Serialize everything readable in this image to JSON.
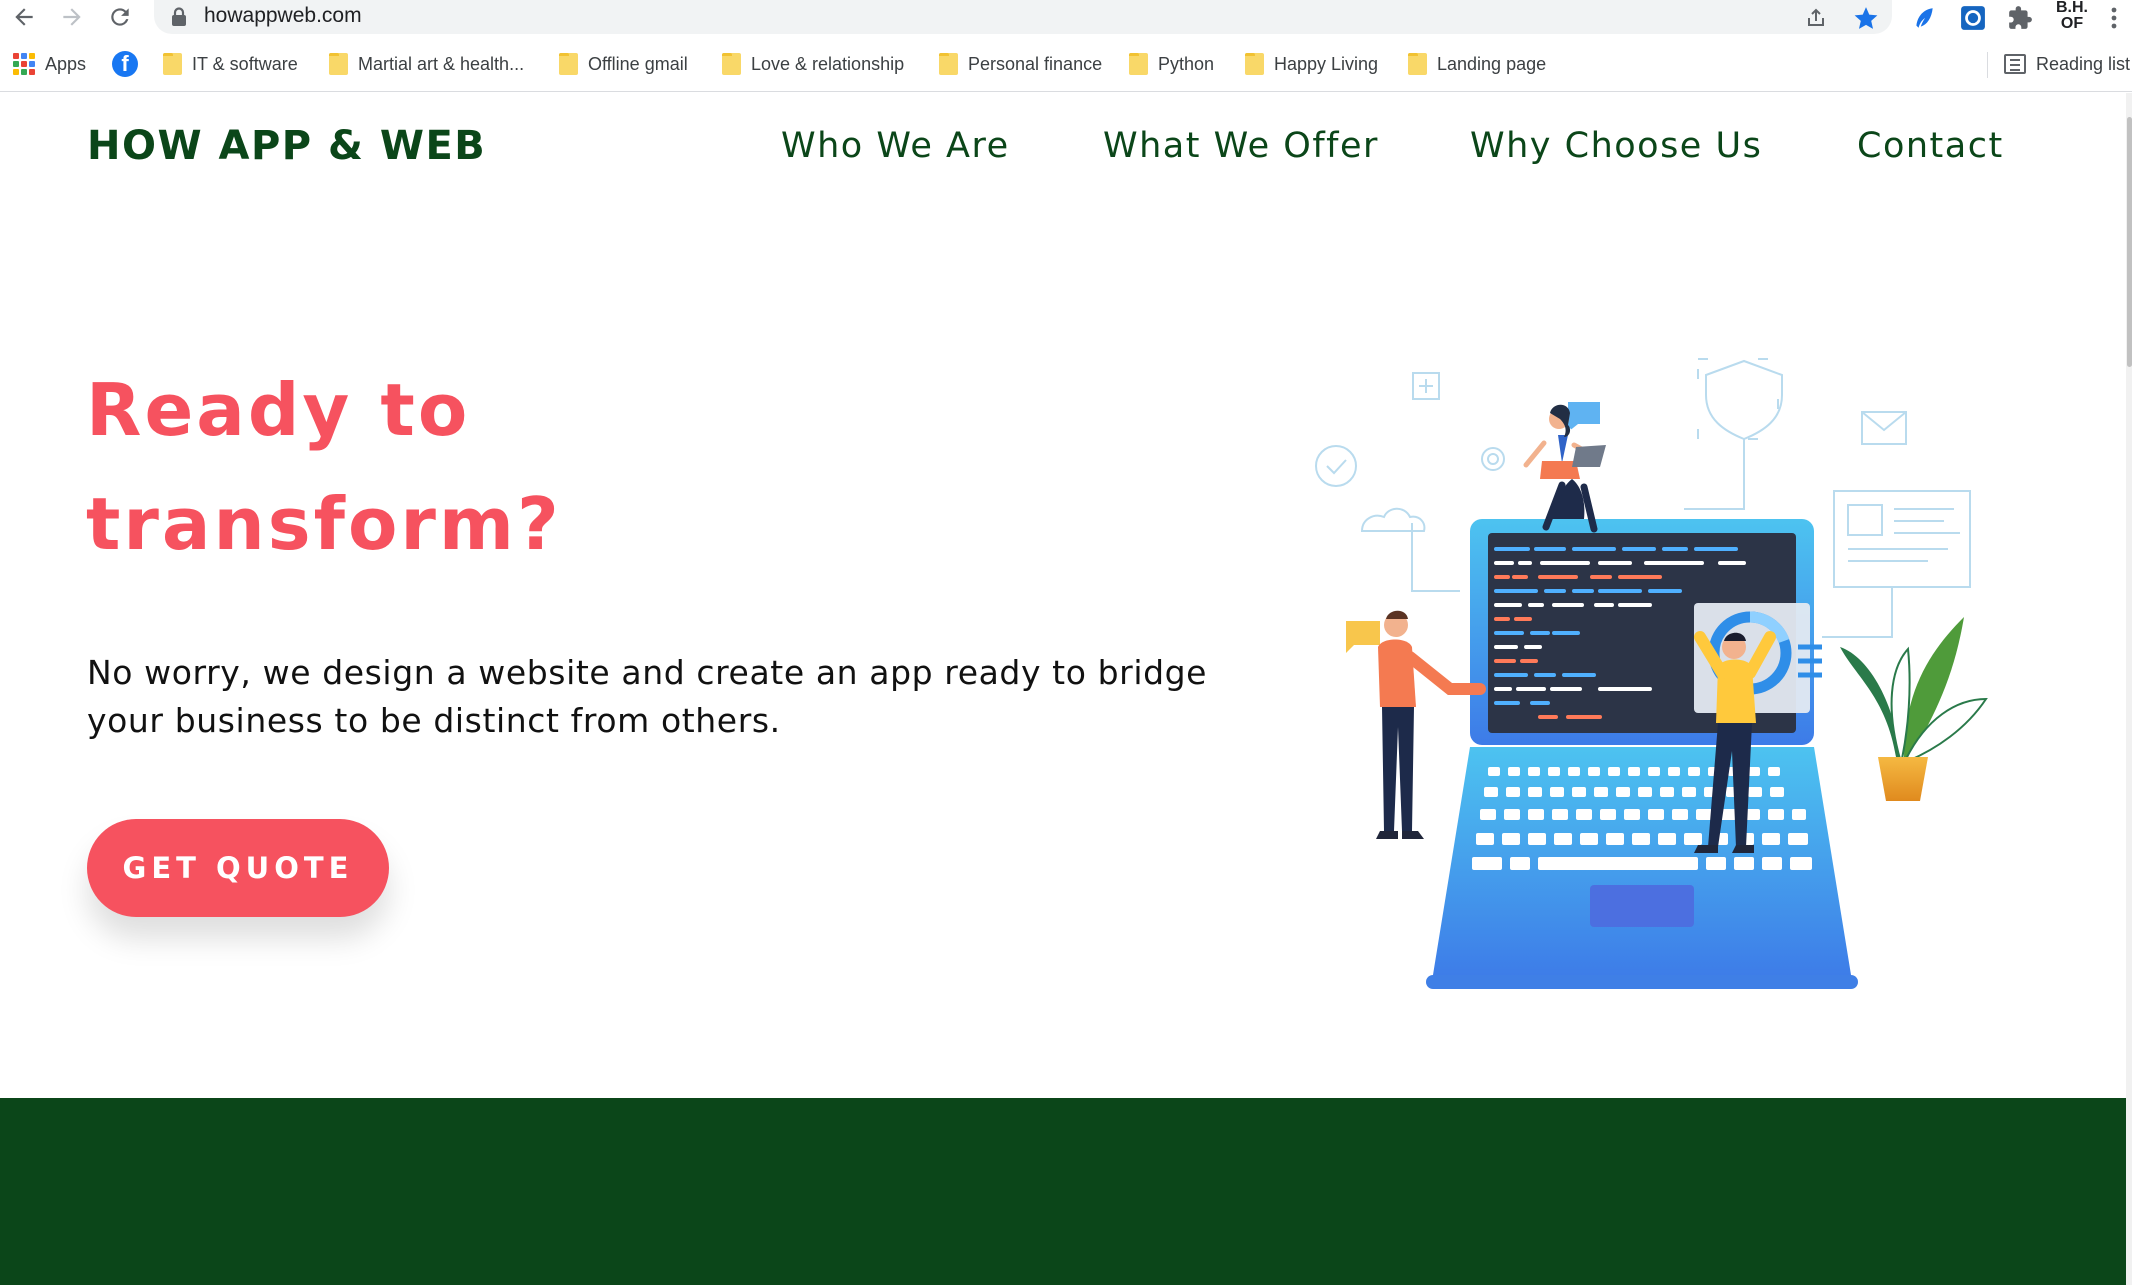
{
  "browser": {
    "url": "howappweb.com",
    "profile_label": "B.H.\nOF",
    "bookmarks": [
      {
        "label": "Apps",
        "icon": "apps-grid-icon"
      },
      {
        "label": "",
        "icon": "facebook-icon"
      },
      {
        "label": "IT & software",
        "icon": "folder-icon"
      },
      {
        "label": "Martial art & health...",
        "icon": "folder-icon"
      },
      {
        "label": "Offline gmail",
        "icon": "folder-icon"
      },
      {
        "label": "Love & relationship",
        "icon": "folder-icon"
      },
      {
        "label": "Personal finance",
        "icon": "folder-icon"
      },
      {
        "label": "Python",
        "icon": "folder-icon"
      },
      {
        "label": "Happy Living",
        "icon": "folder-icon"
      },
      {
        "label": "Landing page",
        "icon": "folder-icon"
      }
    ],
    "reading_list_label": "Reading list"
  },
  "site": {
    "logo": "HOW APP & WEB",
    "nav": [
      {
        "label": "Who We Are"
      },
      {
        "label": "What We Offer"
      },
      {
        "label": "Why Choose Us"
      },
      {
        "label": "Contact"
      }
    ],
    "hero": {
      "title_line1": "Ready to",
      "title_line2": "transform?",
      "description": "No worry, we design a website and create an app ready to bridge your business to be distinct from others.",
      "cta_label": "GET QUOTE"
    }
  },
  "colors": {
    "brand_green": "#0b4619",
    "accent_coral": "#f6525f",
    "browser_blue": "#1a73e8"
  }
}
